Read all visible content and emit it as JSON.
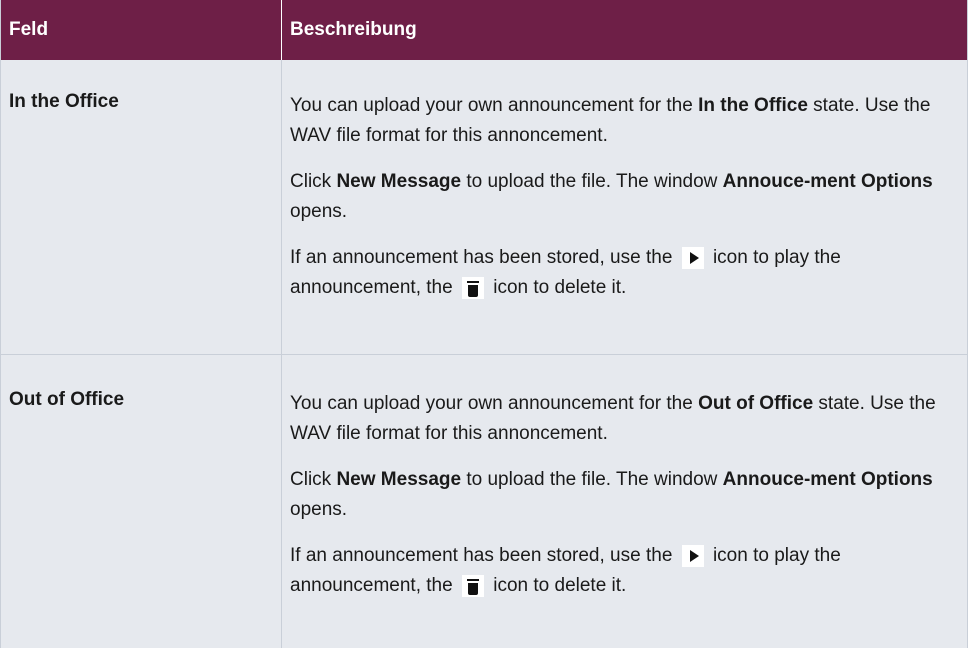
{
  "table": {
    "header": {
      "col1": "Feld",
      "col2": "Beschreibung"
    },
    "rows": [
      {
        "field": "In the Office",
        "p1_pre": "You can upload your own announcement for the ",
        "p1_bold": "In the Office",
        "p1_post": " state. Use the WAV file format for this annoncement.",
        "p2_pre": "Click ",
        "p2_bold1": "New Message",
        "p2_mid": " to upload the file. The window ",
        "p2_bold2": "Annouce-ment Options",
        "p2_post": " opens.",
        "p3_pre": "If an announcement has been stored, use the ",
        "p3_mid": " icon to play the announcement, the ",
        "p3_post": " icon to delete it."
      },
      {
        "field": "Out of Office",
        "p1_pre": "You can upload your own announcement for the ",
        "p1_bold": "Out of Office",
        "p1_post": " state. Use the WAV file format for this annoncement.",
        "p2_pre": "Click ",
        "p2_bold1": "New Message",
        "p2_mid": " to upload the file. The window ",
        "p2_bold2": "Annouce-ment Options",
        "p2_post": " opens.",
        "p3_pre": "If an announcement has been stored, use the ",
        "p3_mid": " icon to play the announcement, the ",
        "p3_post": " icon to delete it."
      }
    ],
    "icons": {
      "play": "play-icon",
      "delete": "trash-icon"
    },
    "colors": {
      "header_bg": "#6e1f47",
      "row_bg": "#e6e9ee"
    }
  }
}
